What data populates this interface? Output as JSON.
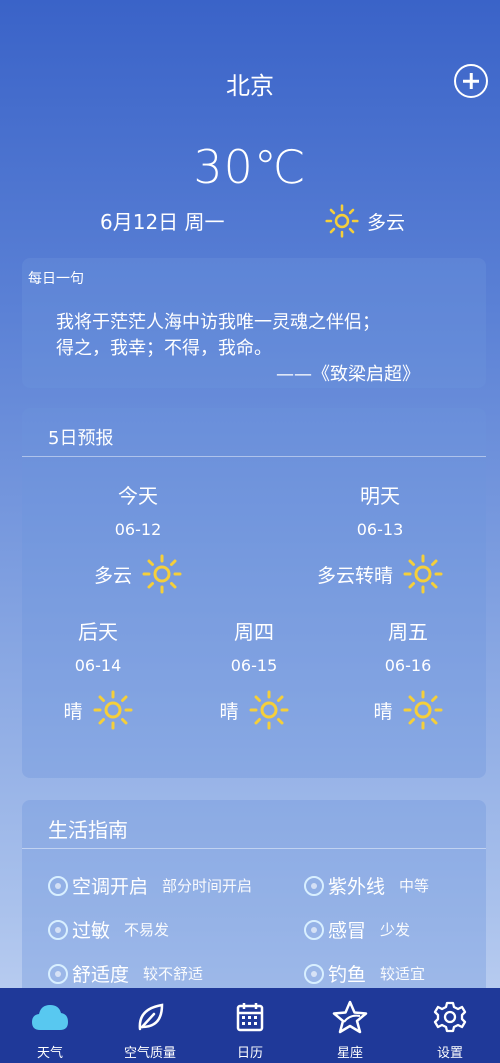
{
  "header": {
    "city": "北京"
  },
  "current": {
    "temp": "30℃",
    "date": "6月12日 周一",
    "condition": "多云"
  },
  "quote": {
    "title": "每日一句",
    "line1": "我将于茫茫人海中访我唯一灵魂之伴侣；",
    "line2": "得之，我幸；不得，我命。",
    "source": "——《致梁启超》"
  },
  "forecast": {
    "title": "5日预报",
    "days": [
      {
        "name": "今天",
        "date": "06-12",
        "cond": "多云"
      },
      {
        "name": "明天",
        "date": "06-13",
        "cond": "多云转晴"
      },
      {
        "name": "后天",
        "date": "06-14",
        "cond": "晴"
      },
      {
        "name": "周四",
        "date": "06-15",
        "cond": "晴"
      },
      {
        "name": "周五",
        "date": "06-16",
        "cond": "晴"
      }
    ]
  },
  "guide": {
    "title": "生活指南",
    "items": [
      {
        "name": "空调开启",
        "value": "部分时间开启",
        "icon": "ac-icon"
      },
      {
        "name": "紫外线",
        "value": "中等",
        "icon": "uv-icon"
      },
      {
        "name": "过敏",
        "value": "不易发",
        "icon": "allergy-icon"
      },
      {
        "name": "感冒",
        "value": "少发",
        "icon": "cold-icon"
      },
      {
        "name": "舒适度",
        "value": "较不舒适",
        "icon": "comfort-icon"
      },
      {
        "name": "钓鱼",
        "value": "较适宜",
        "icon": "fishing-icon"
      }
    ]
  },
  "tabs": [
    {
      "label": "天气",
      "icon": "cloud-icon"
    },
    {
      "label": "空气质量",
      "icon": "leaf-icon"
    },
    {
      "label": "日历",
      "icon": "calendar-icon"
    },
    {
      "label": "星座",
      "icon": "star-icon"
    },
    {
      "label": "设置",
      "icon": "gear-icon"
    }
  ],
  "colors": {
    "sun": "#f5cf3a",
    "tabbar": "#1f3999",
    "active_tab_icon": "#58c8f0"
  }
}
